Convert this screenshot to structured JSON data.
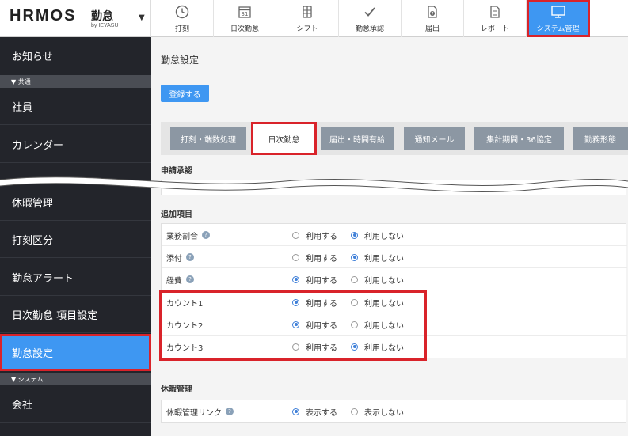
{
  "header": {
    "logo": "HRMOS",
    "logo_product": "勤怠",
    "logo_by": "by IEYASU",
    "nav": [
      {
        "label": "打刻",
        "icon": "clock-icon"
      },
      {
        "label": "日次勤怠",
        "icon": "calendar-icon"
      },
      {
        "label": "シフト",
        "icon": "shift-icon"
      },
      {
        "label": "勤怠承認",
        "icon": "check-icon"
      },
      {
        "label": "届出",
        "icon": "document-upload-icon"
      },
      {
        "label": "レポート",
        "icon": "report-icon"
      },
      {
        "label": "システム管理",
        "icon": "monitor-icon",
        "active": true
      }
    ]
  },
  "sidebar": {
    "items": [
      {
        "label": "お知らせ"
      },
      {
        "section": "▼ 共通"
      },
      {
        "label": "社員"
      },
      {
        "label": "カレンダー"
      },
      {
        "label": "休暇管理"
      },
      {
        "label": "打刻区分"
      },
      {
        "label": "勤怠アラート"
      },
      {
        "label": "日次勤怠 項目設定"
      },
      {
        "label": "勤怠設定",
        "active": true
      },
      {
        "section": "▼ システム"
      },
      {
        "label": "会社"
      }
    ]
  },
  "main": {
    "title": "勤怠設定",
    "register_button": "登録する",
    "tabs": [
      "打刻・端数処理",
      "日次勤怠",
      "届出・時間有給",
      "通知メール",
      "集計期間・36協定",
      "勤務形態"
    ],
    "active_tab": "日次勤怠",
    "section_approval": "申請承認",
    "section_additional": "追加項目",
    "additional_rows": [
      {
        "label": "業務割合",
        "help": true,
        "opt1": "利用する",
        "opt2": "利用しない",
        "selected": 2
      },
      {
        "label": "添付",
        "help": true,
        "opt1": "利用する",
        "opt2": "利用しない",
        "selected": 2
      },
      {
        "label": "経費",
        "help": true,
        "opt1": "利用する",
        "opt2": "利用しない",
        "selected": 1
      },
      {
        "label": "カウント1",
        "help": false,
        "opt1": "利用する",
        "opt2": "利用しない",
        "selected": 1
      },
      {
        "label": "カウント2",
        "help": false,
        "opt1": "利用する",
        "opt2": "利用しない",
        "selected": 1
      },
      {
        "label": "カウント3",
        "help": false,
        "opt1": "利用する",
        "opt2": "利用しない",
        "selected": 2
      }
    ],
    "section_leave": "休暇管理",
    "leave_row": {
      "label": "休暇管理リンク",
      "help": true,
      "opt1": "表示する",
      "opt2": "表示しない",
      "selected": 1
    }
  },
  "colors": {
    "accent": "#3e97f2",
    "highlight": "#d9232a",
    "sidebar": "#23252b"
  }
}
